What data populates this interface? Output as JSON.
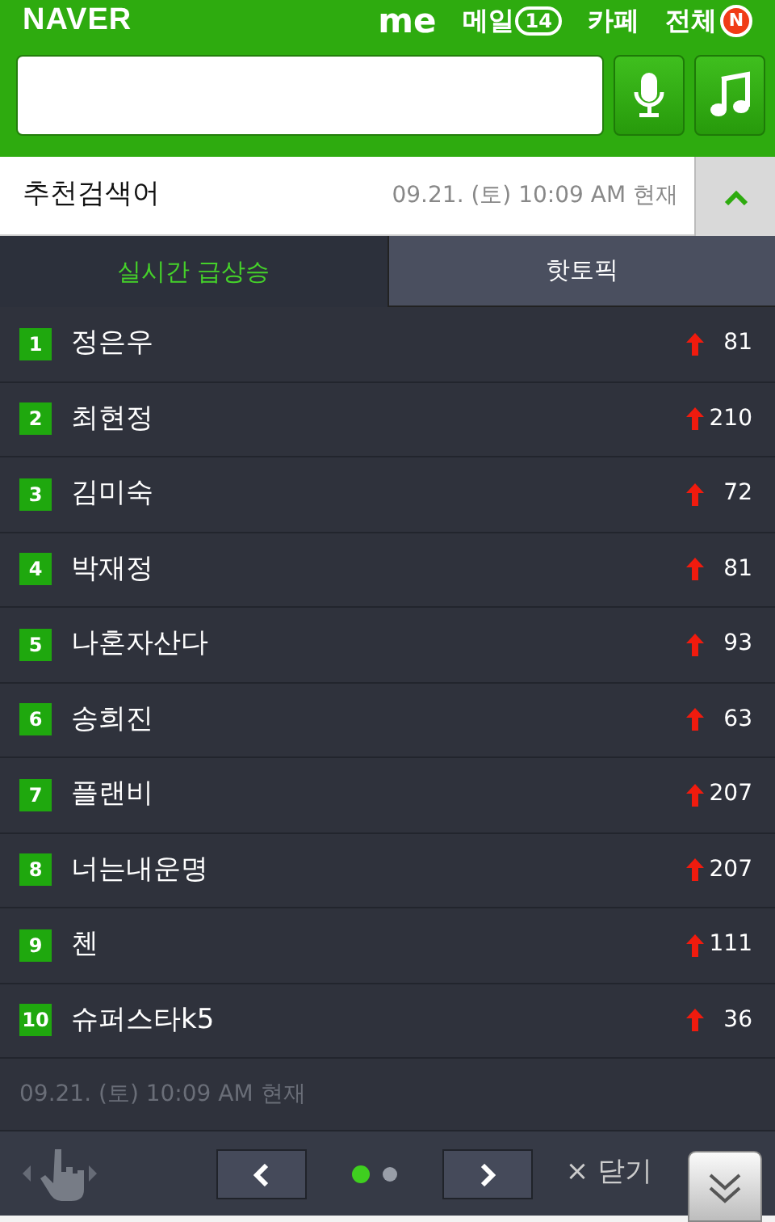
{
  "header": {
    "logo": "NAVER",
    "links": [
      {
        "label": "me",
        "kind": "plain"
      },
      {
        "label": "메일",
        "kind": "count",
        "count": "14"
      },
      {
        "label": "카페",
        "kind": "plain"
      },
      {
        "label": "전체",
        "kind": "new",
        "count": "N"
      }
    ]
  },
  "recommend": {
    "title": "추천검색어",
    "timestamp": "09.21. (토) 10:09 AM 현재",
    "expanded": true
  },
  "tabs": [
    {
      "label": "실시간 급상승",
      "selected": true
    },
    {
      "label": "핫토픽",
      "selected": false
    }
  ],
  "rows": [
    {
      "rank": "1",
      "term": "정은우",
      "change": "81"
    },
    {
      "rank": "2",
      "term": "최현정",
      "change": "210"
    },
    {
      "rank": "3",
      "term": "김미숙",
      "change": "72"
    },
    {
      "rank": "4",
      "term": "박재정",
      "change": "81"
    },
    {
      "rank": "5",
      "term": "나혼자산다",
      "change": "93"
    },
    {
      "rank": "6",
      "term": "송희진",
      "change": "63"
    },
    {
      "rank": "7",
      "term": "플랜비",
      "change": "207"
    },
    {
      "rank": "8",
      "term": "너는내운명",
      "change": "207"
    },
    {
      "rank": "9",
      "term": "첸",
      "change": "111"
    },
    {
      "rank": "10",
      "term": "슈퍼스타k5",
      "change": "36"
    }
  ],
  "footer_timestamp": "09.21. (토) 10:09 AM 현재",
  "pager": {
    "pages": [
      {
        "selected": true
      },
      {
        "selected": false
      }
    ]
  },
  "close": {
    "icon": "×",
    "label": "닫기"
  }
}
